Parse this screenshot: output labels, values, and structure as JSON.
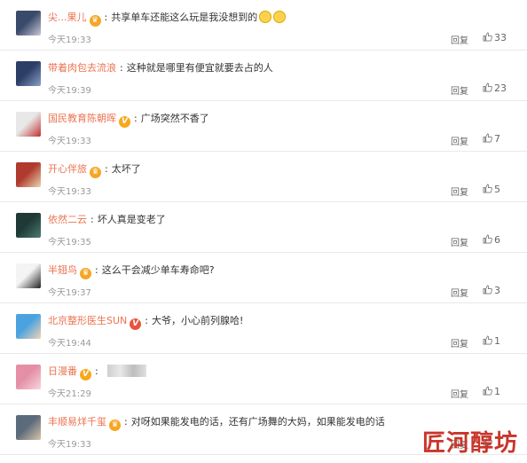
{
  "comments": [
    {
      "name": "尖...果儿",
      "badge": "crown",
      "text": "共享单车还能这么玩是我没想到的",
      "emojis": 2,
      "time": "今天19:33",
      "reply": "回复",
      "likes": "33",
      "avatar": [
        "#3a4a6a",
        "#c8c8d8"
      ]
    },
    {
      "name": "带着肉包去流浪",
      "badge": "",
      "text": "这种就是哪里有便宜就要去占的人",
      "emojis": 0,
      "time": "今天19:39",
      "reply": "回复",
      "likes": "23",
      "avatar": [
        "#2c3e66",
        "#8aa0c8"
      ]
    },
    {
      "name": "国民教育陈朝晖",
      "badge": "v",
      "text": "广场突然不香了",
      "emojis": 0,
      "time": "今天19:33",
      "reply": "回复",
      "likes": "7",
      "avatar": [
        "#e8e8e8",
        "#c03030"
      ]
    },
    {
      "name": "开心伴旅",
      "badge": "crown",
      "text": "太坏了",
      "emojis": 0,
      "time": "今天19:33",
      "reply": "回复",
      "likes": "5",
      "avatar": [
        "#b03a2e",
        "#e9d6b0"
      ]
    },
    {
      "name": "依然二云",
      "badge": "",
      "text": "坏人真是变老了",
      "emojis": 0,
      "time": "今天19:35",
      "reply": "回复",
      "likes": "6",
      "avatar": [
        "#1f3a36",
        "#4c7a70"
      ]
    },
    {
      "name": "半翅鸟",
      "badge": "crown",
      "text": "这么干会减少单车寿命吧?",
      "emojis": 0,
      "time": "今天19:37",
      "reply": "回复",
      "likes": "3",
      "avatar": [
        "#f4f4f4",
        "#222222"
      ]
    },
    {
      "name": "北京整形医生SUN",
      "badge": "v-red",
      "text": "大爷，小心前列腺哈!",
      "emojis": 0,
      "time": "今天19:44",
      "reply": "回复",
      "likes": "1",
      "avatar": [
        "#4aa3df",
        "#f2d3b5"
      ]
    },
    {
      "name": "日漫番",
      "badge": "v",
      "text": "",
      "emojis": 0,
      "blurred": true,
      "time": "今天21:29",
      "reply": "回复",
      "likes": "1",
      "avatar": [
        "#e58fa6",
        "#f7d6de"
      ]
    },
    {
      "name": "丰顺易烊千玺",
      "badge": "crown",
      "text": "对呀如果能发电的话，还有广场舞的大妈，如果能发电的话",
      "emojis": 0,
      "time": "今天19:33",
      "reply": "回复",
      "likes": "",
      "avatar": [
        "#5b6b7b",
        "#d9c4a8"
      ]
    }
  ],
  "watermark": "匠河醇坊"
}
